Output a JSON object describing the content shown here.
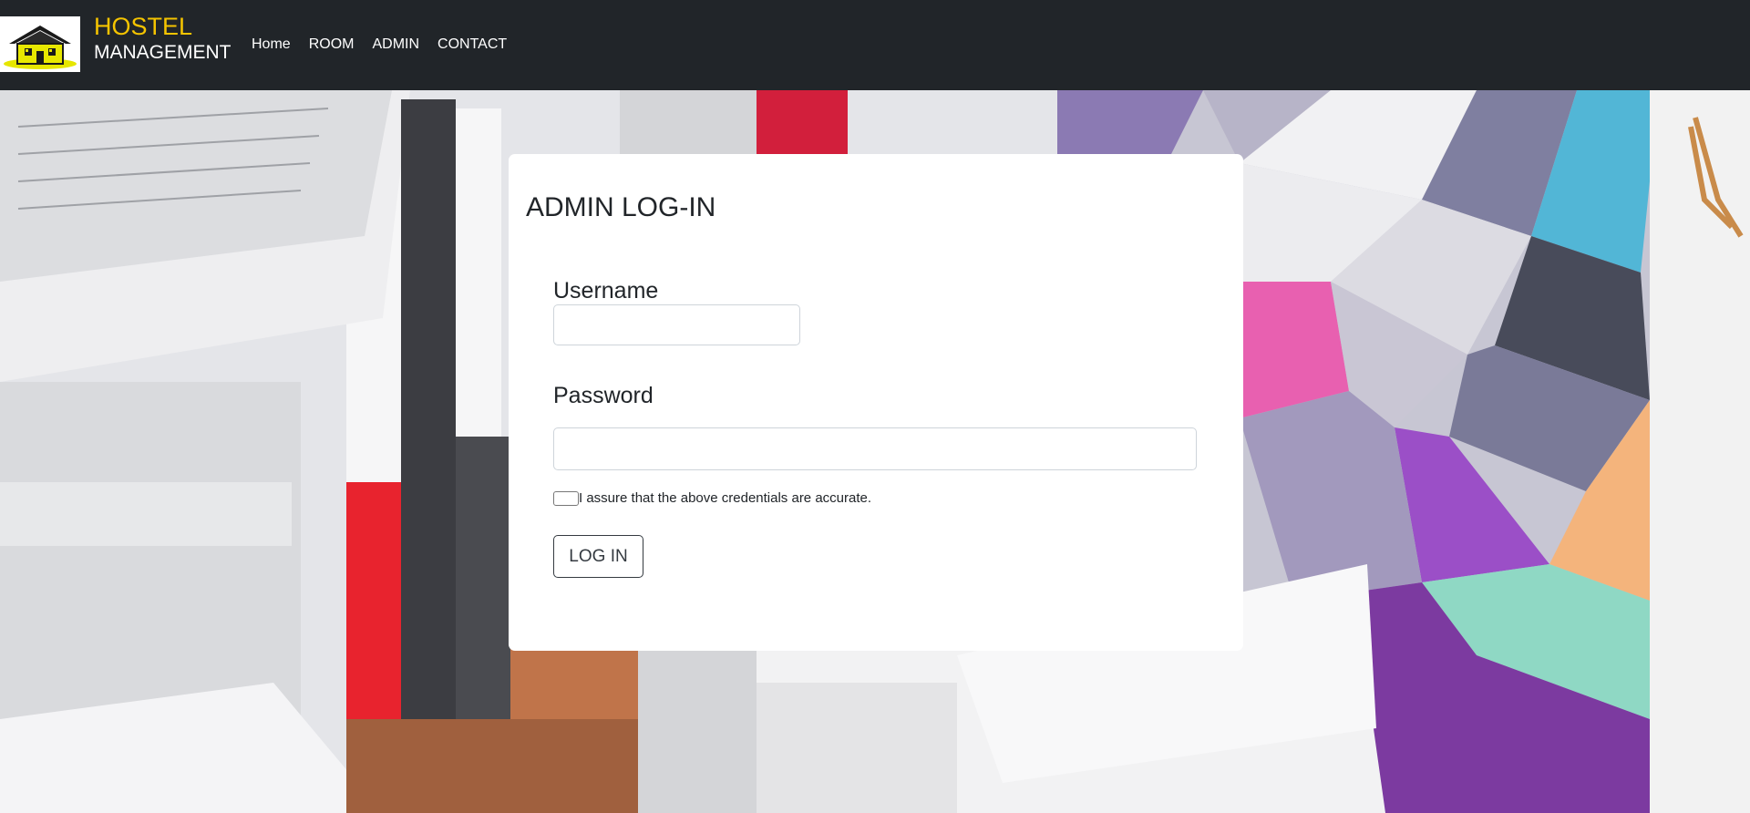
{
  "brand": {
    "line1": "HOSTEL",
    "line2": "MANAGEMENT",
    "accent_color": "#f5c400",
    "logo_icon": "house-icon"
  },
  "nav": {
    "items": [
      "Home",
      "ROOM",
      "ADMIN",
      "CONTACT"
    ]
  },
  "login": {
    "title": "ADMIN LOG-IN",
    "username_label": "Username",
    "username_value": "",
    "password_label": "Password",
    "password_value": "",
    "assurance_text": "I assure that the above credentials are accurate.",
    "submit_label": "LOG IN"
  },
  "colors": {
    "navbar_bg": "#212529",
    "card_bg": "#ffffff"
  }
}
